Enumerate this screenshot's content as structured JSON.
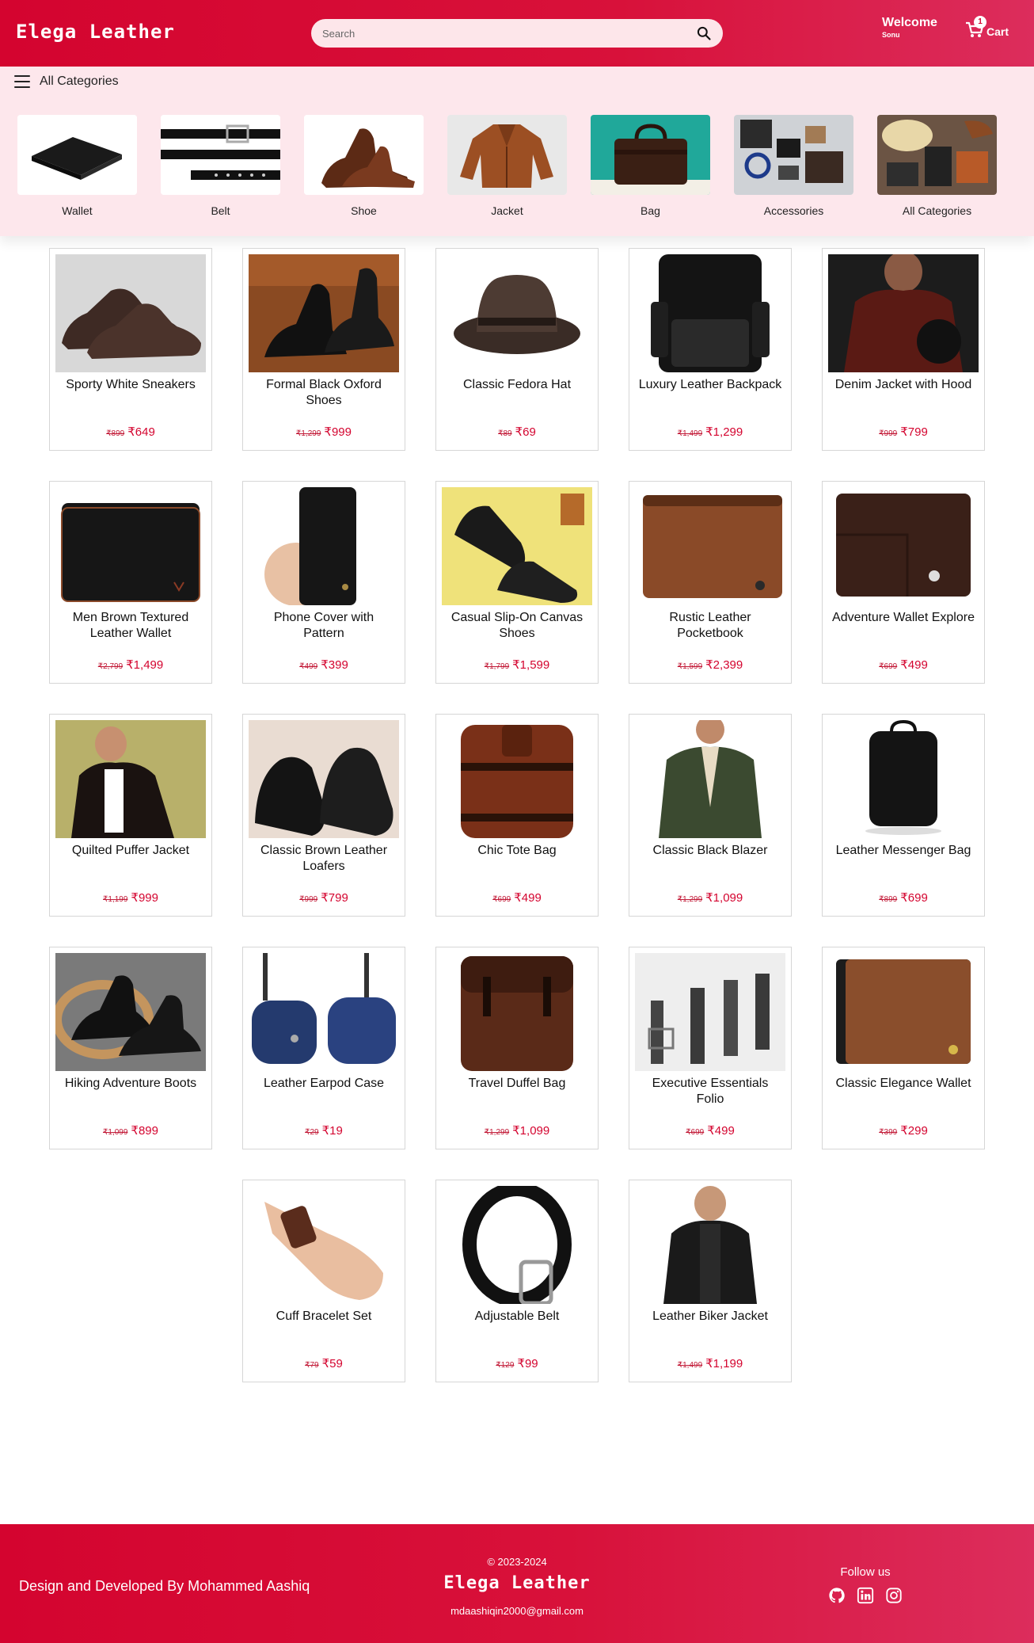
{
  "header": {
    "brand": "Elega Leather",
    "search_placeholder": "Search",
    "welcome": "Welcome",
    "username": "Sonu",
    "cart_count": "1",
    "cart_label": "Cart"
  },
  "category_bar": {
    "all_categories_label": "All Categories",
    "items": [
      {
        "label": "Wallet"
      },
      {
        "label": "Belt"
      },
      {
        "label": "Shoe"
      },
      {
        "label": "Jacket"
      },
      {
        "label": "Bag"
      },
      {
        "label": "Accessories"
      },
      {
        "label": "All Categories"
      }
    ]
  },
  "products": [
    {
      "name": "Sporty White Sneakers",
      "old_price": "₹899",
      "price": "₹649"
    },
    {
      "name": "Formal Black Oxford Shoes",
      "old_price": "₹1,299",
      "price": "₹999"
    },
    {
      "name": "Classic Fedora Hat",
      "old_price": "₹89",
      "price": "₹69"
    },
    {
      "name": "Luxury Leather Backpack",
      "old_price": "₹1,499",
      "price": "₹1,299"
    },
    {
      "name": "Denim Jacket with Hood",
      "old_price": "₹999",
      "price": "₹799"
    },
    {
      "name": "Men Brown Textured Leather Wallet",
      "old_price": "₹2,799",
      "price": "₹1,499"
    },
    {
      "name": "Phone Cover with Pattern",
      "old_price": "₹499",
      "price": "₹399"
    },
    {
      "name": "Casual Slip-On Canvas Shoes",
      "old_price": "₹1,799",
      "price": "₹1,599"
    },
    {
      "name": "Rustic Leather Pocketbook",
      "old_price": "₹1,599",
      "price": "₹2,399"
    },
    {
      "name": "Adventure Wallet Explore",
      "old_price": "₹699",
      "price": "₹499"
    },
    {
      "name": "Quilted Puffer Jacket",
      "old_price": "₹1,199",
      "price": "₹999"
    },
    {
      "name": "Classic Brown Leather Loafers",
      "old_price": "₹999",
      "price": "₹799"
    },
    {
      "name": "Chic Tote Bag",
      "old_price": "₹699",
      "price": "₹499"
    },
    {
      "name": "Classic Black Blazer",
      "old_price": "₹1,299",
      "price": "₹1,099"
    },
    {
      "name": "Leather Messenger Bag",
      "old_price": "₹899",
      "price": "₹699"
    },
    {
      "name": "Hiking Adventure Boots",
      "old_price": "₹1,099",
      "price": "₹899"
    },
    {
      "name": "Leather Earpod Case",
      "old_price": "₹29",
      "price": "₹19"
    },
    {
      "name": "Travel Duffel Bag",
      "old_price": "₹1,299",
      "price": "₹1,099"
    },
    {
      "name": "Executive Essentials Folio",
      "old_price": "₹699",
      "price": "₹499"
    },
    {
      "name": "Classic Elegance Wallet",
      "old_price": "₹399",
      "price": "₹299"
    },
    {
      "name": "Cuff Bracelet Set",
      "old_price": "₹79",
      "price": "₹59"
    },
    {
      "name": "Adjustable Belt",
      "old_price": "₹129",
      "price": "₹99"
    },
    {
      "name": "Leather Biker Jacket",
      "old_price": "₹1,499",
      "price": "₹1,199"
    }
  ],
  "footer": {
    "credit": "Design and Developed By Mohammed Aashiq",
    "copyright": "© 2023-2024",
    "brand": "Elega Leather",
    "email": "mdaashiqin2000@gmail.com",
    "follow_label": "Follow us",
    "social_icons": [
      "github-icon",
      "linkedin-icon",
      "instagram-icon"
    ]
  },
  "colors": {
    "primary": "#d4042f",
    "category_bar_bg": "#fde7ec",
    "price_red": "#d4042f"
  }
}
